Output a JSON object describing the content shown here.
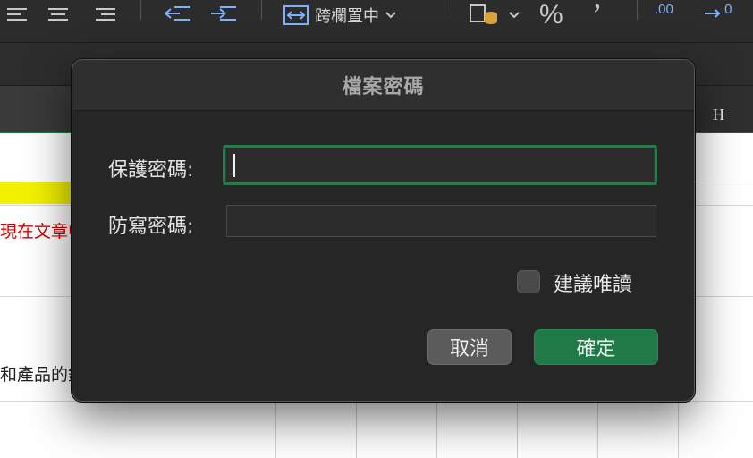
{
  "toolbar": {
    "merge_label": "跨欄置中",
    "percent_symbol": "%",
    "comma_symbol": "’",
    "increase_decimal_text": ".00",
    "decrease_decimal_text": ".0"
  },
  "sheet": {
    "column_header_label": "H",
    "red_text": "現在文章中",
    "black_text": "和產品的銷"
  },
  "dialog": {
    "title": "檔案密碼",
    "protect_password_label": "保護密碼:",
    "write_password_label": "防寫密碼:",
    "protect_password_value": "",
    "write_password_value": "",
    "read_only_label": "建議唯讀",
    "read_only_checked": false,
    "cancel_label": "取消",
    "ok_label": "確定"
  },
  "colors": {
    "accent_green": "#1f7a47",
    "dialog_bg": "#262626",
    "highlight_yellow": "#f2f200",
    "text_red": "#d40000"
  }
}
